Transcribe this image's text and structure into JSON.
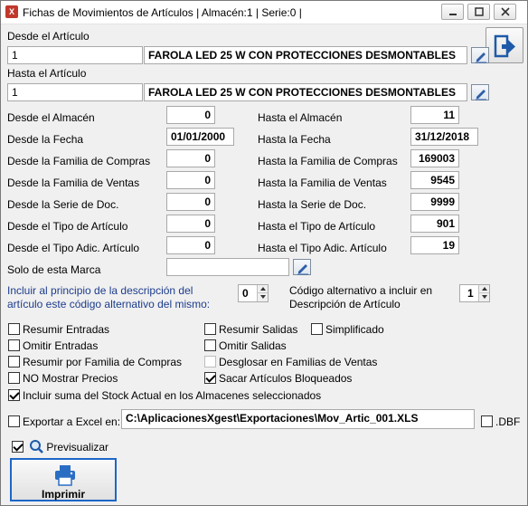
{
  "window": {
    "title": "Fichas de Movimientos de Artículos   | Almacén:1 | Serie:0 |",
    "app_icon": "X"
  },
  "desde_articulo": {
    "label": "Desde el Artículo",
    "code": "1",
    "description": "FAROLA LED 25 W CON PROTECCIONES DESMONTABLES"
  },
  "hasta_articulo": {
    "label": "Hasta el Artículo",
    "code": "1",
    "description": "FAROLA LED 25 W CON PROTECCIONES DESMONTABLES"
  },
  "desde": {
    "almacen": {
      "label": "Desde el Almacén",
      "value": "0"
    },
    "fecha": {
      "label": "Desde la Fecha",
      "value": "01/01/2000"
    },
    "familia_compras": {
      "label": "Desde la Familia de Compras",
      "value": "0"
    },
    "familia_ventas": {
      "label": "Desde la Familia de Ventas",
      "value": "0"
    },
    "serie_doc": {
      "label": "Desde la Serie de Doc.",
      "value": "0"
    },
    "tipo_articulo": {
      "label": "Desde el Tipo de Artículo",
      "value": "0"
    },
    "tipo_adic": {
      "label": "Desde el Tipo Adic. Artículo",
      "value": "0"
    }
  },
  "hasta": {
    "almacen": {
      "label": "Hasta el Almacén",
      "value": "11"
    },
    "fecha": {
      "label": "Hasta la Fecha",
      "value": "31/12/2018"
    },
    "familia_compras": {
      "label": "Hasta la Familia de Compras",
      "value": "169003"
    },
    "familia_ventas": {
      "label": "Hasta la Familia de Ventas",
      "value": "9545"
    },
    "serie_doc": {
      "label": "Hasta la Serie de Doc.",
      "value": "9999"
    },
    "tipo_articulo": {
      "label": "Hasta el Tipo de Artículo",
      "value": "901"
    },
    "tipo_adic": {
      "label": "Hasta el Tipo Adic. Artículo",
      "value": "19"
    }
  },
  "marca": {
    "label": "Solo de esta Marca",
    "value": ""
  },
  "incluir_codigo": {
    "label_line1": "Incluir al principio de la descripción del",
    "label_line2": "artículo este código alternativo del mismo:",
    "value": "0"
  },
  "codigo_alternativo": {
    "label_line1": "Código alternativo a incluir en",
    "label_line2": "Descripción de Artículo",
    "value": "1"
  },
  "options": {
    "resumir_entradas": {
      "label": "Resumir Entradas",
      "checked": false
    },
    "resumir_salidas": {
      "label": "Resumir Salidas",
      "checked": false
    },
    "simplificado": {
      "label": "Simplificado",
      "checked": false
    },
    "omitir_entradas": {
      "label": "Omitir Entradas",
      "checked": false
    },
    "omitir_salidas": {
      "label": "Omitir Salidas",
      "checked": false
    },
    "resumir_familia_compras": {
      "label": "Resumir por Familia de Compras",
      "checked": false
    },
    "desglosar_familias_ventas": {
      "label": "Desglosar en Familias de Ventas",
      "checked": false
    },
    "no_mostrar_precios": {
      "label": "NO Mostrar Precios",
      "checked": false
    },
    "sacar_bloqueados": {
      "label": "Sacar Artículos Bloqueados",
      "checked": true
    },
    "incluir_suma_stock": {
      "label": "Incluir suma del Stock Actual en los Almacenes seleccionados",
      "checked": true
    }
  },
  "exportar": {
    "label": "Exportar a Excel en:",
    "checked": false,
    "path": "C:\\AplicacionesXgest\\Exportaciones\\Mov_Artic_001.XLS",
    "dbf_label": ".DBF",
    "dbf_checked": false
  },
  "previsualizar": {
    "label": "Previsualizar",
    "checked": true
  },
  "imprimir": {
    "label": "Imprimir"
  },
  "colors": {
    "label_blue": "#1c3c8c",
    "focus_border": "#1e66c8"
  }
}
